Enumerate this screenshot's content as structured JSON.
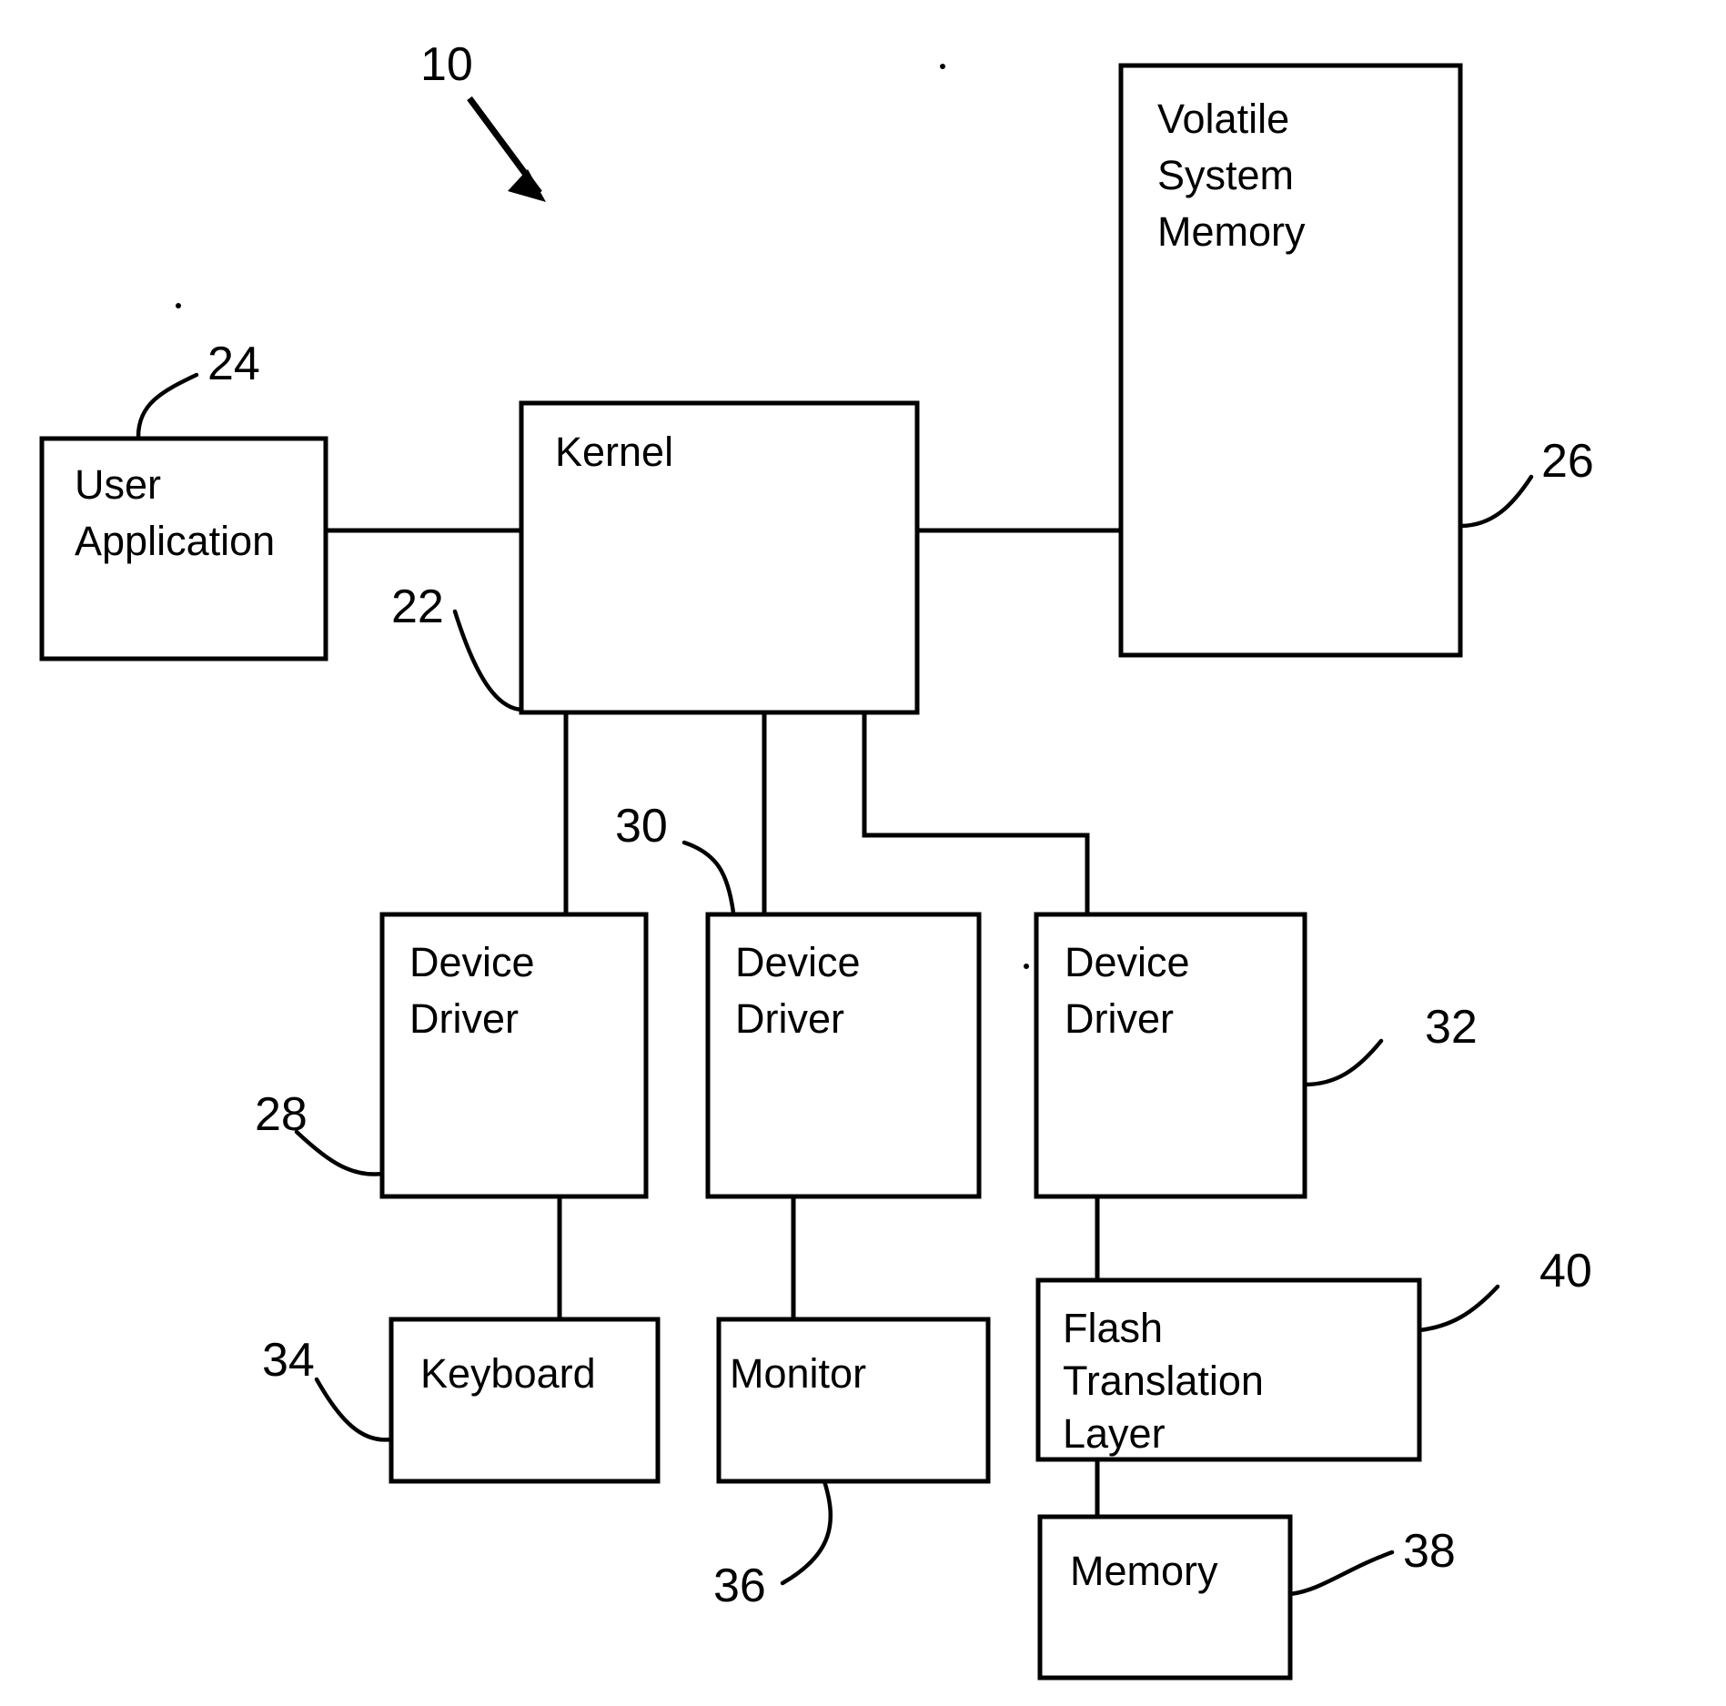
{
  "figure": {
    "main_reference": "10",
    "blocks": [
      {
        "id": "user_application",
        "label_lines": [
          "User",
          "Application"
        ],
        "ref": "24"
      },
      {
        "id": "kernel",
        "label_lines": [
          "Kernel"
        ],
        "ref": "22"
      },
      {
        "id": "volatile_system_memory",
        "label_lines": [
          "Volatile",
          "System",
          "Memory"
        ],
        "ref": "26"
      },
      {
        "id": "device_driver_1",
        "label_lines": [
          "Device",
          "Driver"
        ],
        "ref": "28"
      },
      {
        "id": "device_driver_2",
        "label_lines": [
          "Device",
          "Driver"
        ],
        "ref": "30"
      },
      {
        "id": "device_driver_3",
        "label_lines": [
          "Device",
          "Driver"
        ],
        "ref": "32"
      },
      {
        "id": "keyboard",
        "label_lines": [
          "Keyboard"
        ],
        "ref": "34"
      },
      {
        "id": "monitor",
        "label_lines": [
          "Monitor"
        ],
        "ref": "36"
      },
      {
        "id": "flash_translation_layer",
        "label_lines": [
          "Flash",
          "Translation",
          "Layer"
        ],
        "ref": "40"
      },
      {
        "id": "memory",
        "label_lines": [
          "Memory"
        ],
        "ref": "38"
      }
    ],
    "text": {
      "ref_10": "10",
      "ref_22": "22",
      "ref_24": "24",
      "ref_26": "26",
      "ref_28": "28",
      "ref_30": "30",
      "ref_32": "32",
      "ref_34": "34",
      "ref_36": "36",
      "ref_38": "38",
      "ref_40": "40",
      "user": "User",
      "application": "Application",
      "kernel": "Kernel",
      "volatile": "Volatile",
      "system": "System",
      "memory_word": "Memory",
      "device": "Device",
      "driver": "Driver",
      "keyboard": "Keyboard",
      "monitor": "Monitor",
      "flash": "Flash",
      "translation": "Translation",
      "layer": "Layer"
    },
    "colors": {
      "ink": "#000000",
      "paper": "#ffffff"
    }
  }
}
